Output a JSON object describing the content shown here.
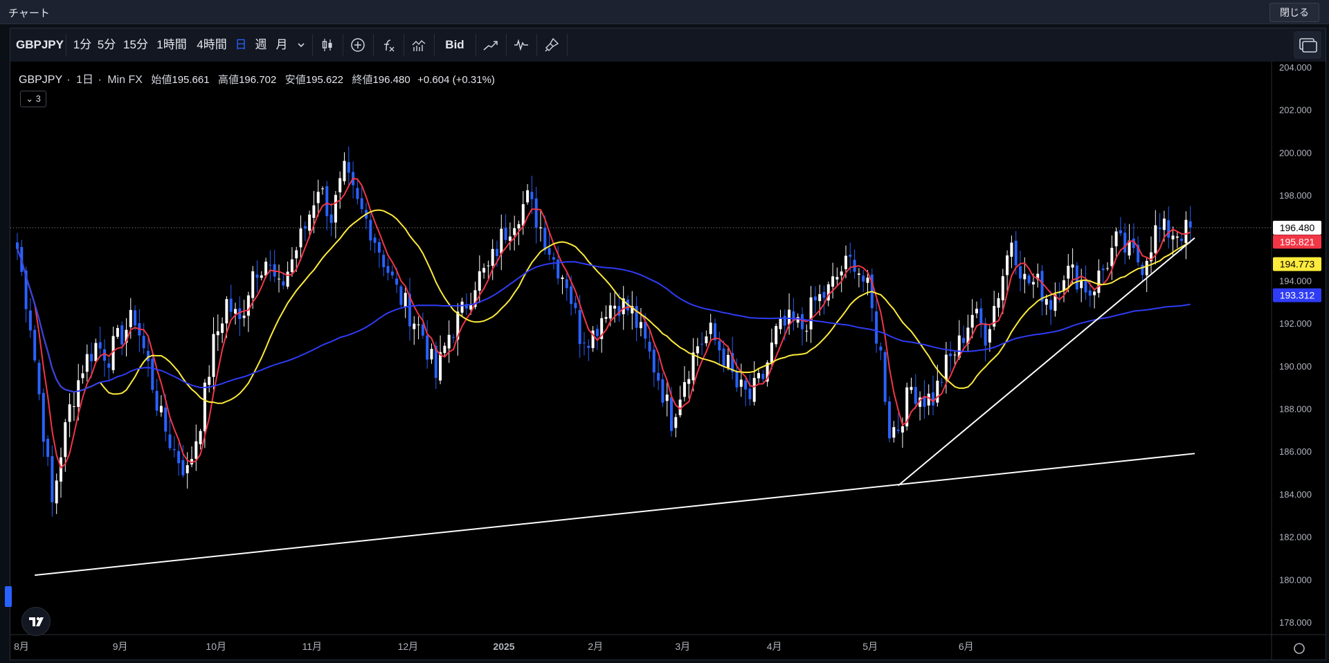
{
  "window": {
    "title": "チャート",
    "close_label": "閉じる"
  },
  "toolbar": {
    "symbol": "GBPJPY",
    "intervals": [
      "1分",
      "5分",
      "15分",
      "1時間",
      "4時間",
      "日",
      "週",
      "月"
    ],
    "active_interval": "日",
    "price_type": "Bid",
    "icons": [
      "interval-dropdown-chevron-icon",
      "candle-style-icon",
      "add-compare-icon",
      "indicators-icon",
      "chart-type-icon",
      "trend-drawing-icon",
      "replay-icon",
      "brush-icon",
      "layout-icon"
    ]
  },
  "legend": {
    "symbol": "GBPJPY",
    "interval": "1日",
    "source": "Min FX",
    "open_label": "始値",
    "open": "195.661",
    "high_label": "高値",
    "high": "196.702",
    "low_label": "安値",
    "low": "195.622",
    "close_label": "終値",
    "close": "196.480",
    "change": "+0.604 (+0.31%)",
    "collapse_count": "3"
  },
  "colors": {
    "up": "#ffffff",
    "down": "#2962ff",
    "ma_fast": "#f23645",
    "ma_mid": "#ffeb3b",
    "ma_slow": "#2f3cf5",
    "trendline": "#ffffff"
  },
  "chart_data": {
    "type": "candlestick",
    "symbol": "GBPJPY",
    "ylim": [
      178.0,
      204.0
    ],
    "y_ticks": [
      "204.000",
      "202.000",
      "200.000",
      "198.000",
      "196.000",
      "194.000",
      "192.000",
      "190.000",
      "188.000",
      "186.000",
      "184.000",
      "182.000",
      "180.000",
      "178.000"
    ],
    "x_labels": [
      "8月",
      "9月",
      "10月",
      "11月",
      "12月",
      "2025",
      "2月",
      "3月",
      "4月",
      "5月",
      "6月"
    ],
    "last_price": "196.480",
    "price_labels": [
      {
        "value": 196.48,
        "text": "196.480",
        "color": "#ffffff",
        "text_color": "#000000"
      },
      {
        "value": 195.821,
        "text": "195.821",
        "color": "#f23645",
        "text_color": "#ffffff"
      },
      {
        "value": 194.773,
        "text": "194.773",
        "color": "#ffeb3b",
        "text_color": "#000000"
      },
      {
        "value": 193.312,
        "text": "193.312",
        "color": "#2f3cf5",
        "text_color": "#ffffff"
      }
    ],
    "close_path": [
      [
        0,
        195.5
      ],
      [
        3,
        192
      ],
      [
        6,
        187
      ],
      [
        8,
        183.5
      ],
      [
        10,
        186
      ],
      [
        12,
        188
      ],
      [
        15,
        190
      ],
      [
        18,
        191
      ],
      [
        21,
        190.5
      ],
      [
        24,
        191.5
      ],
      [
        27,
        192.3
      ],
      [
        30,
        190
      ],
      [
        33,
        187.5
      ],
      [
        36,
        186
      ],
      [
        39,
        185
      ],
      [
        42,
        187.5
      ],
      [
        45,
        191
      ],
      [
        48,
        193
      ],
      [
        51,
        192
      ],
      [
        54,
        194.5
      ],
      [
        57,
        195
      ],
      [
        60,
        193.5
      ],
      [
        63,
        195
      ],
      [
        66,
        196.5
      ],
      [
        69,
        198.5
      ],
      [
        72,
        197
      ],
      [
        75,
        199
      ],
      [
        78,
        197.5
      ],
      [
        81,
        196.5
      ],
      [
        84,
        195
      ],
      [
        87,
        193.5
      ],
      [
        90,
        192.5
      ],
      [
        93,
        191.5
      ],
      [
        96,
        189.5
      ],
      [
        99,
        191.5
      ],
      [
        102,
        192.5
      ],
      [
        105,
        194
      ],
      [
        108,
        194.5
      ],
      [
        111,
        196
      ],
      [
        114,
        197
      ],
      [
        117,
        197.8
      ],
      [
        120,
        196.5
      ],
      [
        123,
        195
      ],
      [
        126,
        194
      ],
      [
        129,
        191.5
      ],
      [
        132,
        191.5
      ],
      [
        135,
        192.8
      ],
      [
        138,
        193
      ],
      [
        141,
        192.5
      ],
      [
        144,
        191
      ],
      [
        147,
        189.5
      ],
      [
        150,
        187.5
      ],
      [
        153,
        189.5
      ],
      [
        156,
        191
      ],
      [
        159,
        191.5
      ],
      [
        162,
        190.5
      ],
      [
        165,
        189
      ],
      [
        168,
        188.5
      ],
      [
        171,
        189.5
      ],
      [
        174,
        191.5
      ],
      [
        177,
        192
      ],
      [
        180,
        191.8
      ],
      [
        183,
        193
      ],
      [
        186,
        193.5
      ],
      [
        189,
        194.5
      ],
      [
        192,
        195
      ],
      [
        195,
        193.5
      ],
      [
        198,
        190.5
      ],
      [
        200,
        187
      ],
      [
        202,
        187.2
      ],
      [
        205,
        189
      ],
      [
        208,
        188.5
      ],
      [
        210,
        188.5
      ],
      [
        213,
        190
      ],
      [
        216,
        191
      ],
      [
        219,
        192.5
      ],
      [
        222,
        191.5
      ],
      [
        225,
        193.5
      ],
      [
        228,
        196
      ],
      [
        231,
        194
      ],
      [
        234,
        193.8
      ],
      [
        237,
        193
      ],
      [
        240,
        194.5
      ],
      [
        243,
        194.2
      ],
      [
        246,
        193.5
      ],
      [
        249,
        194.5
      ],
      [
        252,
        195.8
      ],
      [
        255,
        195.3
      ],
      [
        258,
        194.8
      ],
      [
        261,
        196.3
      ]
    ],
    "support_line": {
      "from": [
        4,
        180.2
      ],
      "to": [
        270,
        185.9
      ]
    },
    "rising_line": {
      "from": [
        202,
        184.4
      ],
      "to": [
        270,
        196.0
      ]
    },
    "series": [
      {
        "name": "MA fast",
        "period": 5,
        "color": "#f23645"
      },
      {
        "name": "MA mid",
        "period": 20,
        "color": "#ffeb3b"
      },
      {
        "name": "MA slow",
        "period": 75,
        "color": "#2f3cf5"
      }
    ]
  }
}
